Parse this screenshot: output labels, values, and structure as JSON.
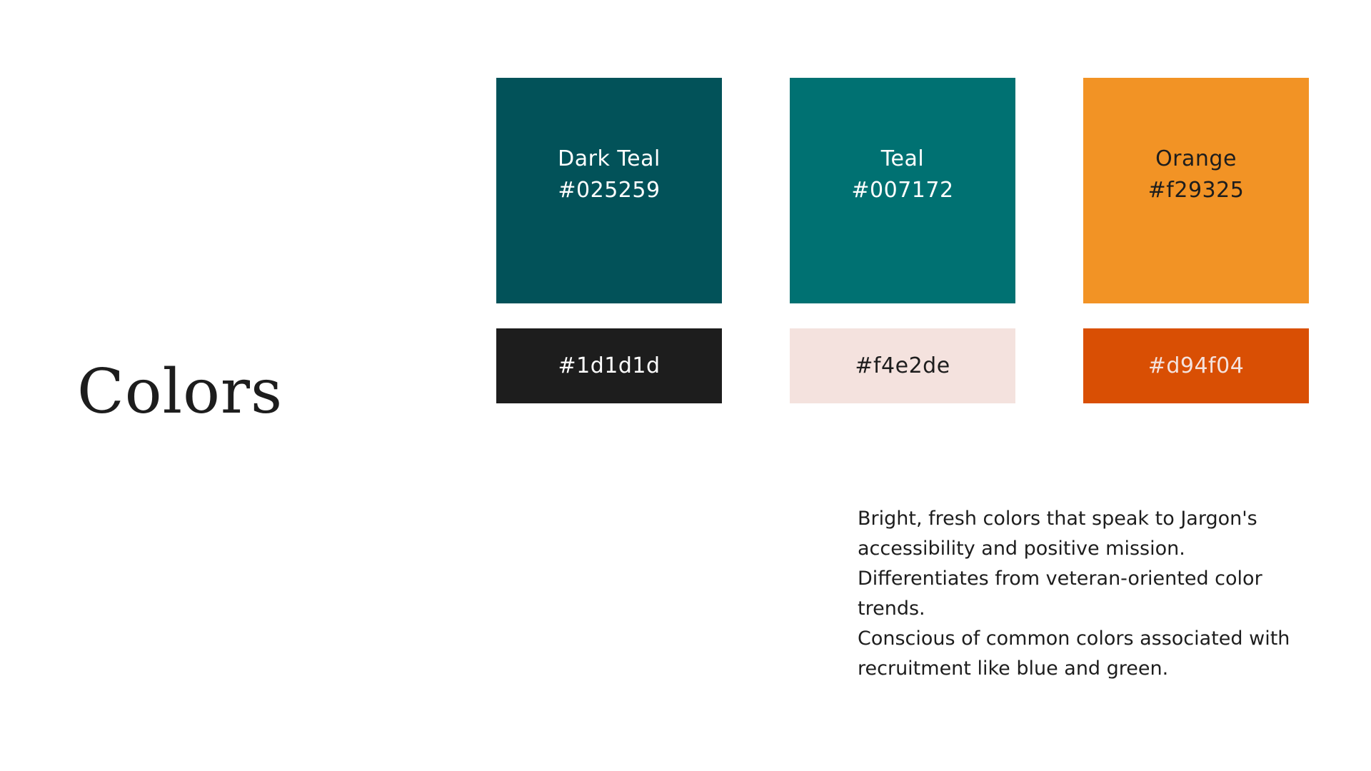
{
  "page": {
    "title": "Colors"
  },
  "swatches": {
    "primary": [
      {
        "name": "Dark Teal",
        "hex": "#025259"
      },
      {
        "name": "Teal",
        "hex": "#007172"
      },
      {
        "name": "Orange",
        "hex": "#f29325"
      }
    ],
    "secondary": [
      {
        "hex": "#1d1d1d"
      },
      {
        "hex": "#f4e2de"
      },
      {
        "hex": "#d94f04"
      }
    ]
  },
  "description": {
    "lines": [
      "Bright, fresh colors that speak to Jargon's accessibility and positive mission.",
      "Differentiates from veteran-oriented color trends.",
      "Conscious of common colors associated with recruitment like blue and green."
    ]
  }
}
